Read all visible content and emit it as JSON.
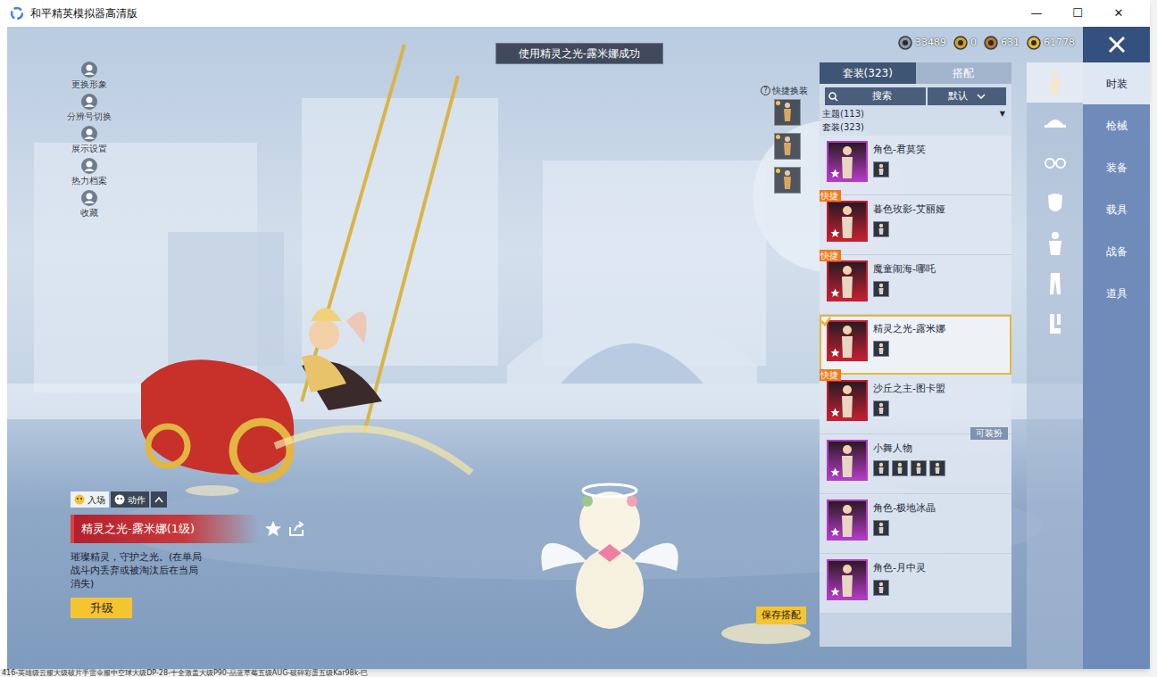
{
  "window": {
    "title": "和平精英模拟器高清版",
    "controls": [
      "—",
      "☐",
      "✕"
    ]
  },
  "desktop": {
    "taskbar_text": "416-英雄级云服大级破片手雷伞服中空球大级DP-28-十全激盖大级P90-品蓝草莓五级AUG-破碎彩蛋五级Kar98k-巳"
  },
  "toast": "使用精灵之光-露米娜成功",
  "currencies": [
    {
      "amount": "33489",
      "color": "#8e97a8"
    },
    {
      "amount": "0",
      "color": "#d6a21e"
    },
    {
      "amount": "631",
      "color": "#b9762a"
    },
    {
      "amount": "61778",
      "color": "#e7b82e"
    }
  ],
  "left_menu": [
    {
      "label": "更换形象"
    },
    {
      "label": "分辨号切换"
    },
    {
      "label": "展示设置"
    },
    {
      "label": "热力档案"
    },
    {
      "label": "收藏"
    }
  ],
  "quick_change": {
    "label": "快捷换装",
    "help": "?"
  },
  "panel": {
    "tabs": [
      {
        "label": "套装(323)",
        "selected": true
      },
      {
        "label": "搭配",
        "selected": false
      }
    ],
    "search": {
      "label": "搜索"
    },
    "sort": {
      "label": "默认"
    },
    "filter": {
      "label": "主题(113)",
      "arrow": "▼"
    },
    "section": "套装(323)",
    "items": [
      {
        "name": "角色-君莫笑",
        "color": "#b23bc4",
        "badge": null,
        "tag": null,
        "selected": false,
        "parts": 1
      },
      {
        "name": "暮色玫影-艾丽娅",
        "color": "#c21f32",
        "badge": "快捷",
        "tag": null,
        "selected": false,
        "parts": 1
      },
      {
        "name": "魔童闹海-哪吒",
        "color": "#c21f32",
        "badge": "快捷",
        "tag": null,
        "selected": false,
        "parts": 1
      },
      {
        "name": "精灵之光-露米娜",
        "color": "#c21f32",
        "badge": null,
        "tag": null,
        "selected": true,
        "parts": 1
      },
      {
        "name": "沙丘之主-图卡盟",
        "color": "#c21f32",
        "badge": "快捷",
        "tag": null,
        "selected": false,
        "parts": 1
      },
      {
        "name": "小舞人物",
        "color": "#b23bc4",
        "badge": null,
        "tag": "可装扮",
        "selected": false,
        "parts": 4
      },
      {
        "name": "角色-极地冰晶",
        "color": "#b23bc4",
        "badge": null,
        "tag": null,
        "selected": false,
        "parts": 1
      },
      {
        "name": "角色-月中灵",
        "color": "#b23bc4",
        "badge": null,
        "tag": null,
        "selected": false,
        "parts": 1
      }
    ]
  },
  "categories": [
    {
      "selected": true
    },
    {
      "selected": false
    },
    {
      "selected": false
    },
    {
      "selected": false
    },
    {
      "selected": false
    },
    {
      "selected": false
    },
    {
      "selected": false
    }
  ],
  "main_tabs": [
    {
      "label": "时装",
      "selected": true
    },
    {
      "label": "枪械",
      "selected": false
    },
    {
      "label": "装备",
      "selected": false
    },
    {
      "label": "载具",
      "selected": false
    },
    {
      "label": "战备",
      "selected": false
    },
    {
      "label": "道具",
      "selected": false
    }
  ],
  "preview": {
    "tabs": [
      {
        "label": "入场",
        "selected": true
      },
      {
        "label": "动作",
        "selected": false
      }
    ],
    "title": "精灵之光-露米娜(1级)",
    "description": "璀璨精灵，守护之光。(在单局战斗内丢弃或被淘汰后在当局消失)",
    "upgrade": "升级"
  },
  "save_button": "保存搭配"
}
